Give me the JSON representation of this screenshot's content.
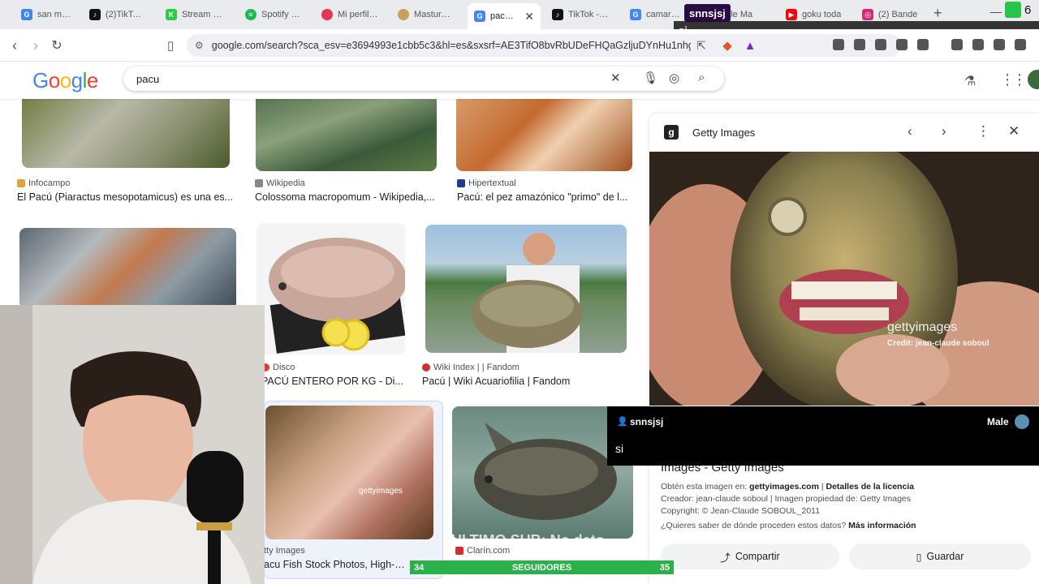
{
  "browser": {
    "tabs": [
      {
        "label": "san martin",
        "fav_color": "#4285f4"
      },
      {
        "label": "(2)TikTok -",
        "fav_color": "#111111"
      },
      {
        "label": "Stream - Ki",
        "fav_color": "#2ecc40"
      },
      {
        "label": "Spotify – Bu",
        "fav_color": "#1db954"
      },
      {
        "label": "Mi perfil | T",
        "fav_color": "#e8345a"
      },
      {
        "label": "Masturbadi",
        "fav_color": "#c8a060"
      },
      {
        "label": "pacu -",
        "fav_color": "#4285f4"
      },
      {
        "label": "TikTok - Ma",
        "fav_color": "#111111"
      },
      {
        "label": "camaro zl",
        "fav_color": "#4285f4"
      },
      {
        "label": "ogle Ma",
        "fav_color": "#4285f4"
      },
      {
        "label": "goku toda",
        "fav_color": "#ff0000"
      },
      {
        "label": "(2) Bande",
        "fav_color": "#d62976"
      }
    ],
    "url": "google.com/search?sca_esv=e3694993e1cbb5c3&hl=es&sxsrf=AE3TifO8bvRbUDeFHQaGzljuDYnHu1nhg:1",
    "overlay_chat_name": "snnsjsj",
    "overlay_chat_msg": "si",
    "badge_count": "6"
  },
  "google": {
    "logo": "Google",
    "query": "pacu"
  },
  "results": [
    {
      "source": "Infocampo",
      "caption": "El Pacú (Piaractus mesopotamicus) es una es...",
      "src_color": "#e6a23c"
    },
    {
      "source": "Wikipedia",
      "caption": "Colossoma macropomum - Wikipedia,...",
      "src_color": "#888888"
    },
    {
      "source": "Hipertextual",
      "caption": "Pacú: el pez amazónico \"primo\" de l...",
      "src_color": "#1a3d8f"
    },
    {
      "source": "Disco",
      "caption": "PACÚ ENTERO POR KG - Di...",
      "src_color": "#e53935"
    },
    {
      "source": "Wiki Index | | Fandom",
      "caption": "Pacú | Wiki Acuariofilia | Fandom",
      "src_color": "#d32f2f"
    },
    {
      "source": "tty Images",
      "caption": "acu Fish Stock Photos, High-Res",
      "src_color": "#222222"
    },
    {
      "source": "Clarín.com",
      "caption": "",
      "src_color": "#d32f2f"
    }
  ],
  "panel": {
    "site": "Getty Images",
    "watermark": "gettyimages",
    "credit": "Credit: jean-claude soboul",
    "title": "Images - Getty Images",
    "meta1_pre": "Obtén esta imagen en: ",
    "meta1_link": "gettyimages.com",
    "meta1_sep": " | ",
    "meta1_link2": "Detalles de la licencia",
    "meta2": "Creador: jean-claude soboul | Imagen propiedad de: Getty Images",
    "meta3": "Copyright: © Jean-Claude SOBOUL_2011",
    "meta4_pre": "¿Quieres saber de dónde proceden estos datos? ",
    "meta4_link": "Más información",
    "share": "Compartir",
    "save": "Guardar"
  },
  "chat": {
    "user": "snnsjsj",
    "gender": "Male",
    "message": "si"
  },
  "goal": {
    "current": "34",
    "label": "SEGUIDORES",
    "target": "35"
  },
  "ticker": "ULTIMO SUB: No dato"
}
